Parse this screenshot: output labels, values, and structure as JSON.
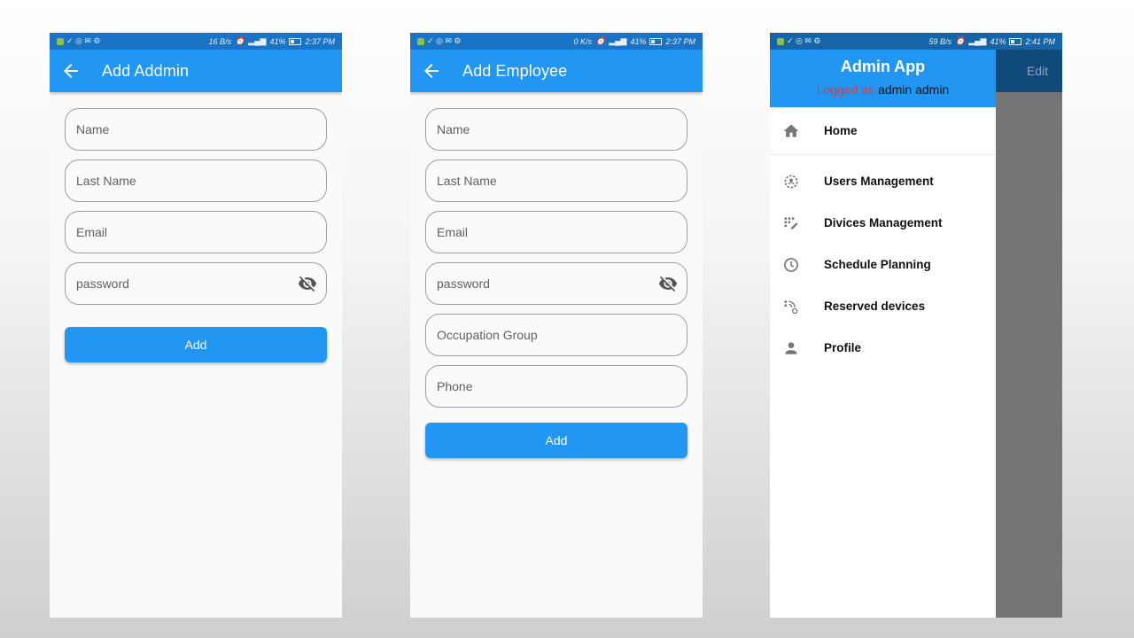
{
  "phones": [
    {
      "status": {
        "speed": "16 B/s",
        "battery": "41%",
        "time": "2:37 PM"
      },
      "appbar_title": "Add Addmin",
      "fields": [
        {
          "placeholder": "Name"
        },
        {
          "placeholder": "Last Name"
        },
        {
          "placeholder": "Email"
        },
        {
          "placeholder": "password"
        }
      ],
      "button_label": "Add"
    },
    {
      "status": {
        "speed": "0 K/s",
        "battery": "41%",
        "time": "2:37 PM"
      },
      "appbar_title": "Add Employee",
      "fields": [
        {
          "placeholder": "Name"
        },
        {
          "placeholder": "Last Name"
        },
        {
          "placeholder": "Email"
        },
        {
          "placeholder": "password"
        },
        {
          "placeholder": "Occupation Group"
        },
        {
          "placeholder": "Phone"
        }
      ],
      "button_label": "Add"
    },
    {
      "status": {
        "speed": "59 B/s",
        "battery": "41%",
        "time": "2:41 PM"
      },
      "background_action": "Edit",
      "drawer": {
        "title": "Admin App",
        "logged_as": "Logged as",
        "user": "admin admin",
        "items": [
          {
            "label": "Home",
            "icon": "home-icon"
          },
          {
            "label": "Users Management",
            "icon": "users-gear-icon"
          },
          {
            "label": "Divices Management",
            "icon": "devices-icon"
          },
          {
            "label": "Schedule Planning",
            "icon": "clock-icon"
          },
          {
            "label": "Reserved devices",
            "icon": "reserved-devices-icon"
          },
          {
            "label": "Profile",
            "icon": "person-icon"
          }
        ]
      }
    }
  ],
  "colors": {
    "primary": "#2196f3",
    "status_bar": "#1a73c4",
    "logged_as_red": "#e53935",
    "scrim": "#757575"
  }
}
